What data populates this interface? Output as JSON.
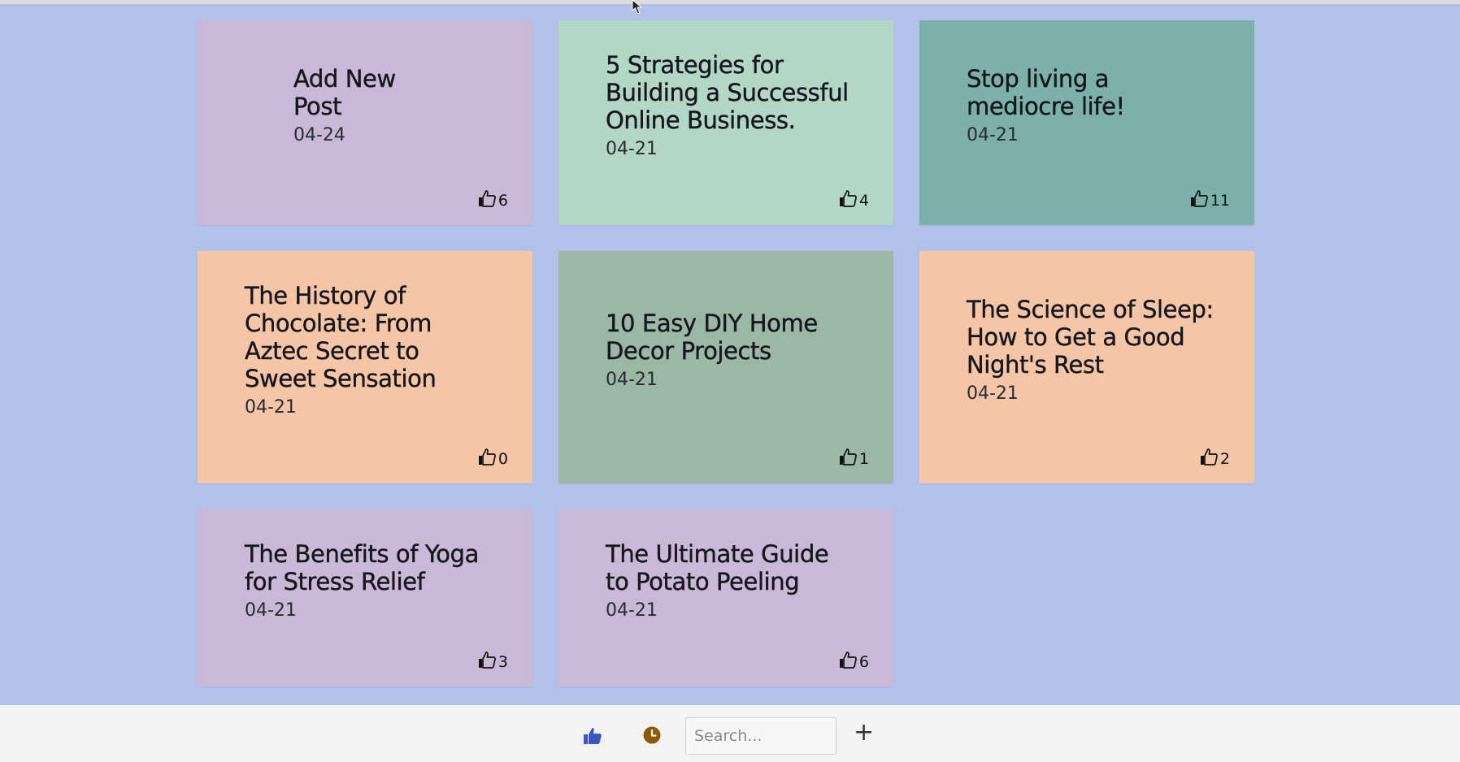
{
  "colors": {
    "background": "#b2c1ea",
    "purple": "#c9b8d6",
    "mint": "#b2d7c4",
    "teal": "#7bb1aa",
    "peach": "#f4c6a5",
    "sage": "#9bb8a4",
    "footer": "#f3f3f3",
    "like_icon": "#3d55bf",
    "clock_icon": "#8b5a06"
  },
  "posts": [
    {
      "title": "Add New Post",
      "date": "04-24",
      "likes": "6",
      "color": "#c9b8d6"
    },
    {
      "title": "5 Strategies for Building a Successful Online Business.",
      "date": "04-21",
      "likes": "4",
      "color": "#b2d7c4"
    },
    {
      "title": "Stop living a mediocre life!",
      "date": "04-21",
      "likes": "11",
      "color": "#7bb1aa"
    },
    {
      "title": "The History of Chocolate: From Aztec Secret to Sweet Sensation",
      "date": "04-21",
      "likes": "0",
      "color": "#f4c6a5"
    },
    {
      "title": "10 Easy DIY Home Decor Projects",
      "date": "04-21",
      "likes": "1",
      "color": "#9bb8a4"
    },
    {
      "title": "The Science of Sleep: How to Get a Good Night's Rest",
      "date": "04-21",
      "likes": "2",
      "color": "#f4c6a5"
    },
    {
      "title": "The Benefits of Yoga for Stress Relief",
      "date": "04-21",
      "likes": "3",
      "color": "#c9b8d6"
    },
    {
      "title": "The Ultimate Guide to Potato Peeling",
      "date": "04-21",
      "likes": "6",
      "color": "#c9b8d6"
    }
  ],
  "footer": {
    "sort_likes_icon": "thumbs-up-icon",
    "sort_recent_icon": "clock-icon",
    "search_placeholder": "Search...",
    "add_label": "+"
  }
}
